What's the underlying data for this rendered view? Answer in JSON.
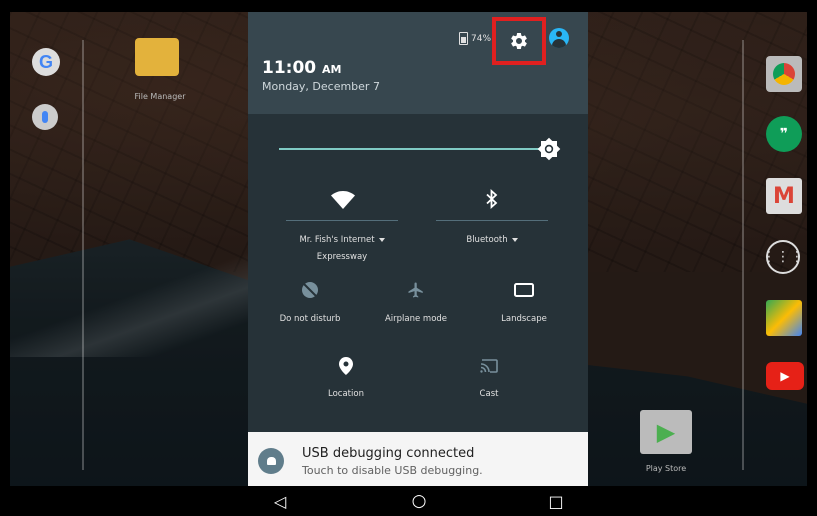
{
  "home": {
    "google_letter": "G",
    "file_manager_label": "File Manager",
    "play_store_label": "Play Store",
    "hangouts_glyph": "❞",
    "gmail_letter": "M",
    "apps_glyph": "⋮⋮⋮",
    "youtube_glyph": "▶",
    "play_glyph": "▶"
  },
  "status": {
    "battery_text": "74%"
  },
  "header": {
    "time": "11:00",
    "ampm": "AM",
    "date": "Monday, December 7"
  },
  "brightness": {
    "level": 1.0
  },
  "tiles": {
    "wifi_label": "Mr. Fish's Internet",
    "wifi_sub": "Expressway",
    "bluetooth_label": "Bluetooth",
    "dnd_label": "Do not disturb",
    "airplane_label": "Airplane mode",
    "rotation_label": "Landscape",
    "location_label": "Location",
    "cast_label": "Cast"
  },
  "notification": {
    "title": "USB debugging connected",
    "text": "Touch to disable USB debugging."
  },
  "navbar": {
    "back_glyph": "◁",
    "home_glyph": "○",
    "recents_glyph": "□"
  },
  "colors": {
    "highlight": "#e02020",
    "accent": "#80cbc4",
    "account": "#29b6f6"
  }
}
